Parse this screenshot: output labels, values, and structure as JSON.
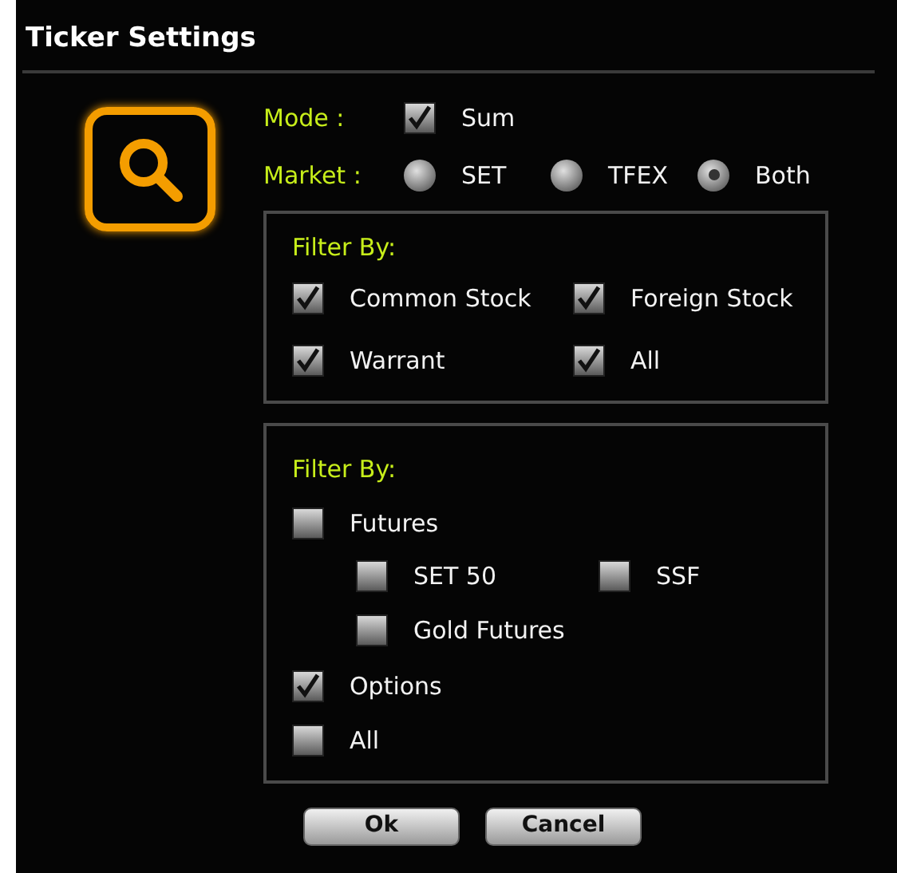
{
  "dialog": {
    "title": "Ticker Settings",
    "mode": {
      "label": "Mode :",
      "option": {
        "label": "Sum",
        "checked": true
      }
    },
    "market": {
      "label": "Market :",
      "options": [
        {
          "label": "SET",
          "selected": false
        },
        {
          "label": "TFEX",
          "selected": false
        },
        {
          "label": "Both",
          "selected": true
        }
      ]
    },
    "stock_filter": {
      "title": "Filter By:",
      "items": [
        {
          "label": "Common Stock",
          "checked": true
        },
        {
          "label": "Foreign Stock",
          "checked": true
        },
        {
          "label": "Warrant",
          "checked": true
        },
        {
          "label": "All",
          "checked": true
        }
      ]
    },
    "derivative_filter": {
      "title": "Filter By:",
      "items": [
        {
          "label": "Futures",
          "checked": false,
          "children": [
            {
              "label": "SET 50",
              "checked": false
            },
            {
              "label": "SSF",
              "checked": false
            },
            {
              "label": "Gold Futures",
              "checked": false
            }
          ]
        },
        {
          "label": "Options",
          "checked": true
        },
        {
          "label": "All",
          "checked": false
        }
      ]
    },
    "buttons": [
      "Ok",
      "Cancel"
    ]
  }
}
